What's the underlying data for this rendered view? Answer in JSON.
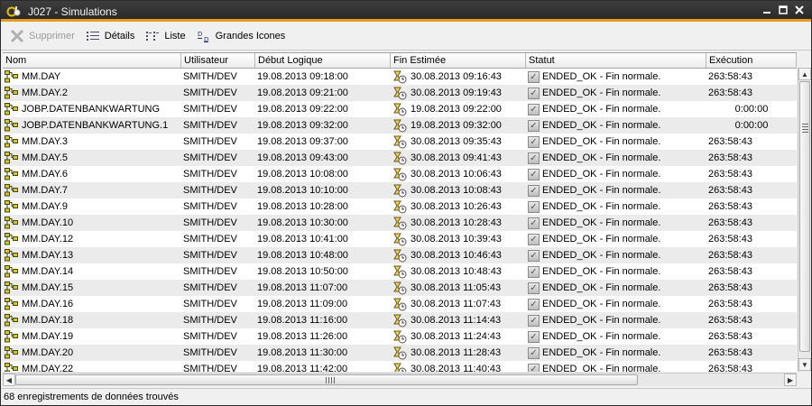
{
  "window": {
    "title": "J027 - Simulations",
    "controls": [
      "minimize",
      "maximize",
      "close"
    ]
  },
  "toolbar": {
    "delete_label": "Supprimer",
    "details_label": "Détails",
    "list_label": "Liste",
    "large_icons_label": "Grandes Icones"
  },
  "table": {
    "columns": [
      "Nom",
      "Utilisateur",
      "Début Logique",
      "Fin Estimée",
      "Statut",
      "Exécution"
    ],
    "rows": [
      [
        "MM.DAY",
        "SMITH/DEV",
        "19.08.2013 09:18:00",
        "30.08.2013 09:16:43",
        "ENDED_OK - Fin normale.",
        "263:58:43"
      ],
      [
        "MM.DAY.2",
        "SMITH/DEV",
        "19.08.2013 09:21:00",
        "30.08.2013 09:19:43",
        "ENDED_OK - Fin normale.",
        "263:58:43"
      ],
      [
        "JOBP.DATENBANKWARTUNG",
        "SMITH/DEV",
        "19.08.2013 09:22:00",
        "19.08.2013 09:22:00",
        "ENDED_OK - Fin normale.",
        "0:00:00"
      ],
      [
        "JOBP.DATENBANKWARTUNG.1",
        "SMITH/DEV",
        "19.08.2013 09:32:00",
        "19.08.2013 09:32:00",
        "ENDED_OK - Fin normale.",
        "0:00:00"
      ],
      [
        "MM.DAY.3",
        "SMITH/DEV",
        "19.08.2013 09:37:00",
        "30.08.2013 09:35:43",
        "ENDED_OK - Fin normale.",
        "263:58:43"
      ],
      [
        "MM.DAY.5",
        "SMITH/DEV",
        "19.08.2013 09:43:00",
        "30.08.2013 09:41:43",
        "ENDED_OK - Fin normale.",
        "263:58:43"
      ],
      [
        "MM.DAY.6",
        "SMITH/DEV",
        "19.08.2013 10:08:00",
        "30.08.2013 10:06:43",
        "ENDED_OK - Fin normale.",
        "263:58:43"
      ],
      [
        "MM.DAY.7",
        "SMITH/DEV",
        "19.08.2013 10:10:00",
        "30.08.2013 10:08:43",
        "ENDED_OK - Fin normale.",
        "263:58:43"
      ],
      [
        "MM.DAY.9",
        "SMITH/DEV",
        "19.08.2013 10:28:00",
        "30.08.2013 10:26:43",
        "ENDED_OK - Fin normale.",
        "263:58:43"
      ],
      [
        "MM.DAY.10",
        "SMITH/DEV",
        "19.08.2013 10:30:00",
        "30.08.2013 10:28:43",
        "ENDED_OK - Fin normale.",
        "263:58:43"
      ],
      [
        "MM.DAY.12",
        "SMITH/DEV",
        "19.08.2013 10:41:00",
        "30.08.2013 10:39:43",
        "ENDED_OK - Fin normale.",
        "263:58:43"
      ],
      [
        "MM.DAY.13",
        "SMITH/DEV",
        "19.08.2013 10:48:00",
        "30.08.2013 10:46:43",
        "ENDED_OK - Fin normale.",
        "263:58:43"
      ],
      [
        "MM.DAY.14",
        "SMITH/DEV",
        "19.08.2013 10:50:00",
        "30.08.2013 10:48:43",
        "ENDED_OK - Fin normale.",
        "263:58:43"
      ],
      [
        "MM.DAY.15",
        "SMITH/DEV",
        "19.08.2013 11:07:00",
        "30.08.2013 11:05:43",
        "ENDED_OK - Fin normale.",
        "263:58:43"
      ],
      [
        "MM.DAY.16",
        "SMITH/DEV",
        "19.08.2013 11:09:00",
        "30.08.2013 11:07:43",
        "ENDED_OK - Fin normale.",
        "263:58:43"
      ],
      [
        "MM.DAY.18",
        "SMITH/DEV",
        "19.08.2013 11:16:00",
        "30.08.2013 11:14:43",
        "ENDED_OK - Fin normale.",
        "263:58:43"
      ],
      [
        "MM.DAY.19",
        "SMITH/DEV",
        "19.08.2013 11:26:00",
        "30.08.2013 11:24:43",
        "ENDED_OK - Fin normale.",
        "263:58:43"
      ],
      [
        "MM.DAY.20",
        "SMITH/DEV",
        "19.08.2013 11:30:00",
        "30.08.2013 11:28:43",
        "ENDED_OK - Fin normale.",
        "263:58:43"
      ],
      [
        "MM.DAY.22",
        "SMITH/DEV",
        "19.08.2013 11:42:00",
        "30.08.2013 11:40:43",
        "ENDED_OK - Fin normale.",
        "263:58:43"
      ]
    ]
  },
  "status_bar": {
    "text": "68 enregistrements de données trouvés"
  },
  "colors": {
    "title_bar": "#2e2e2e",
    "accent": "#e89a1d",
    "row_alt": "#ebebeb"
  },
  "icons": {
    "app": "tools-icon",
    "delete": "x-icon",
    "details": "details-view-icon",
    "list": "list-view-icon",
    "large_icons": "large-icons-view-icon",
    "job": "job-workflow-icon",
    "estimate": "clock-hourglass-icon",
    "status": "checkbox-checked-icon"
  }
}
